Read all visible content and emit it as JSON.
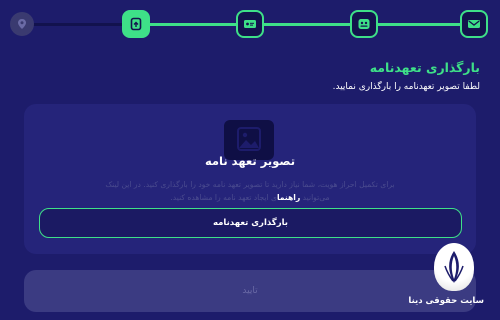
{
  "stepper": {
    "steps": [
      {
        "icon": "location-pin-icon",
        "state": "todo"
      },
      {
        "icon": "document-upload-icon",
        "state": "current"
      },
      {
        "icon": "id-card-icon",
        "state": "done"
      },
      {
        "icon": "people-icon",
        "state": "done"
      },
      {
        "icon": "mail-icon",
        "state": "done"
      }
    ]
  },
  "header": {
    "title": "بارگذاری تعهدنامه",
    "subtitle": "لطفا تصویر تعهدنامه را بارگذاری نمایید."
  },
  "upload_card": {
    "icon": "image-placeholder-icon",
    "title": "تصویر تعهد نامه",
    "desc_line1": "برای تکمیل احراز هویت، شما نیاز دارید تا تصویر تعهد نامه خود را بارگذاری کنید. در این لینک",
    "desc_line2_prefix": "می‌توانید",
    "desc_link": "راهنما",
    "desc_line2_suffix": "ی ایجاد تعهد نامه را مشاهده کنید.",
    "button_label": "بارگذاری تعهدنامه"
  },
  "confirm": {
    "label": "تایید"
  },
  "watermark": {
    "text": "سایت حقوقی دینا",
    "logo_icon": "feather-logo-icon"
  },
  "colors": {
    "background": "#1d1c6b",
    "accent": "#3ee088",
    "card": "#25247a"
  }
}
